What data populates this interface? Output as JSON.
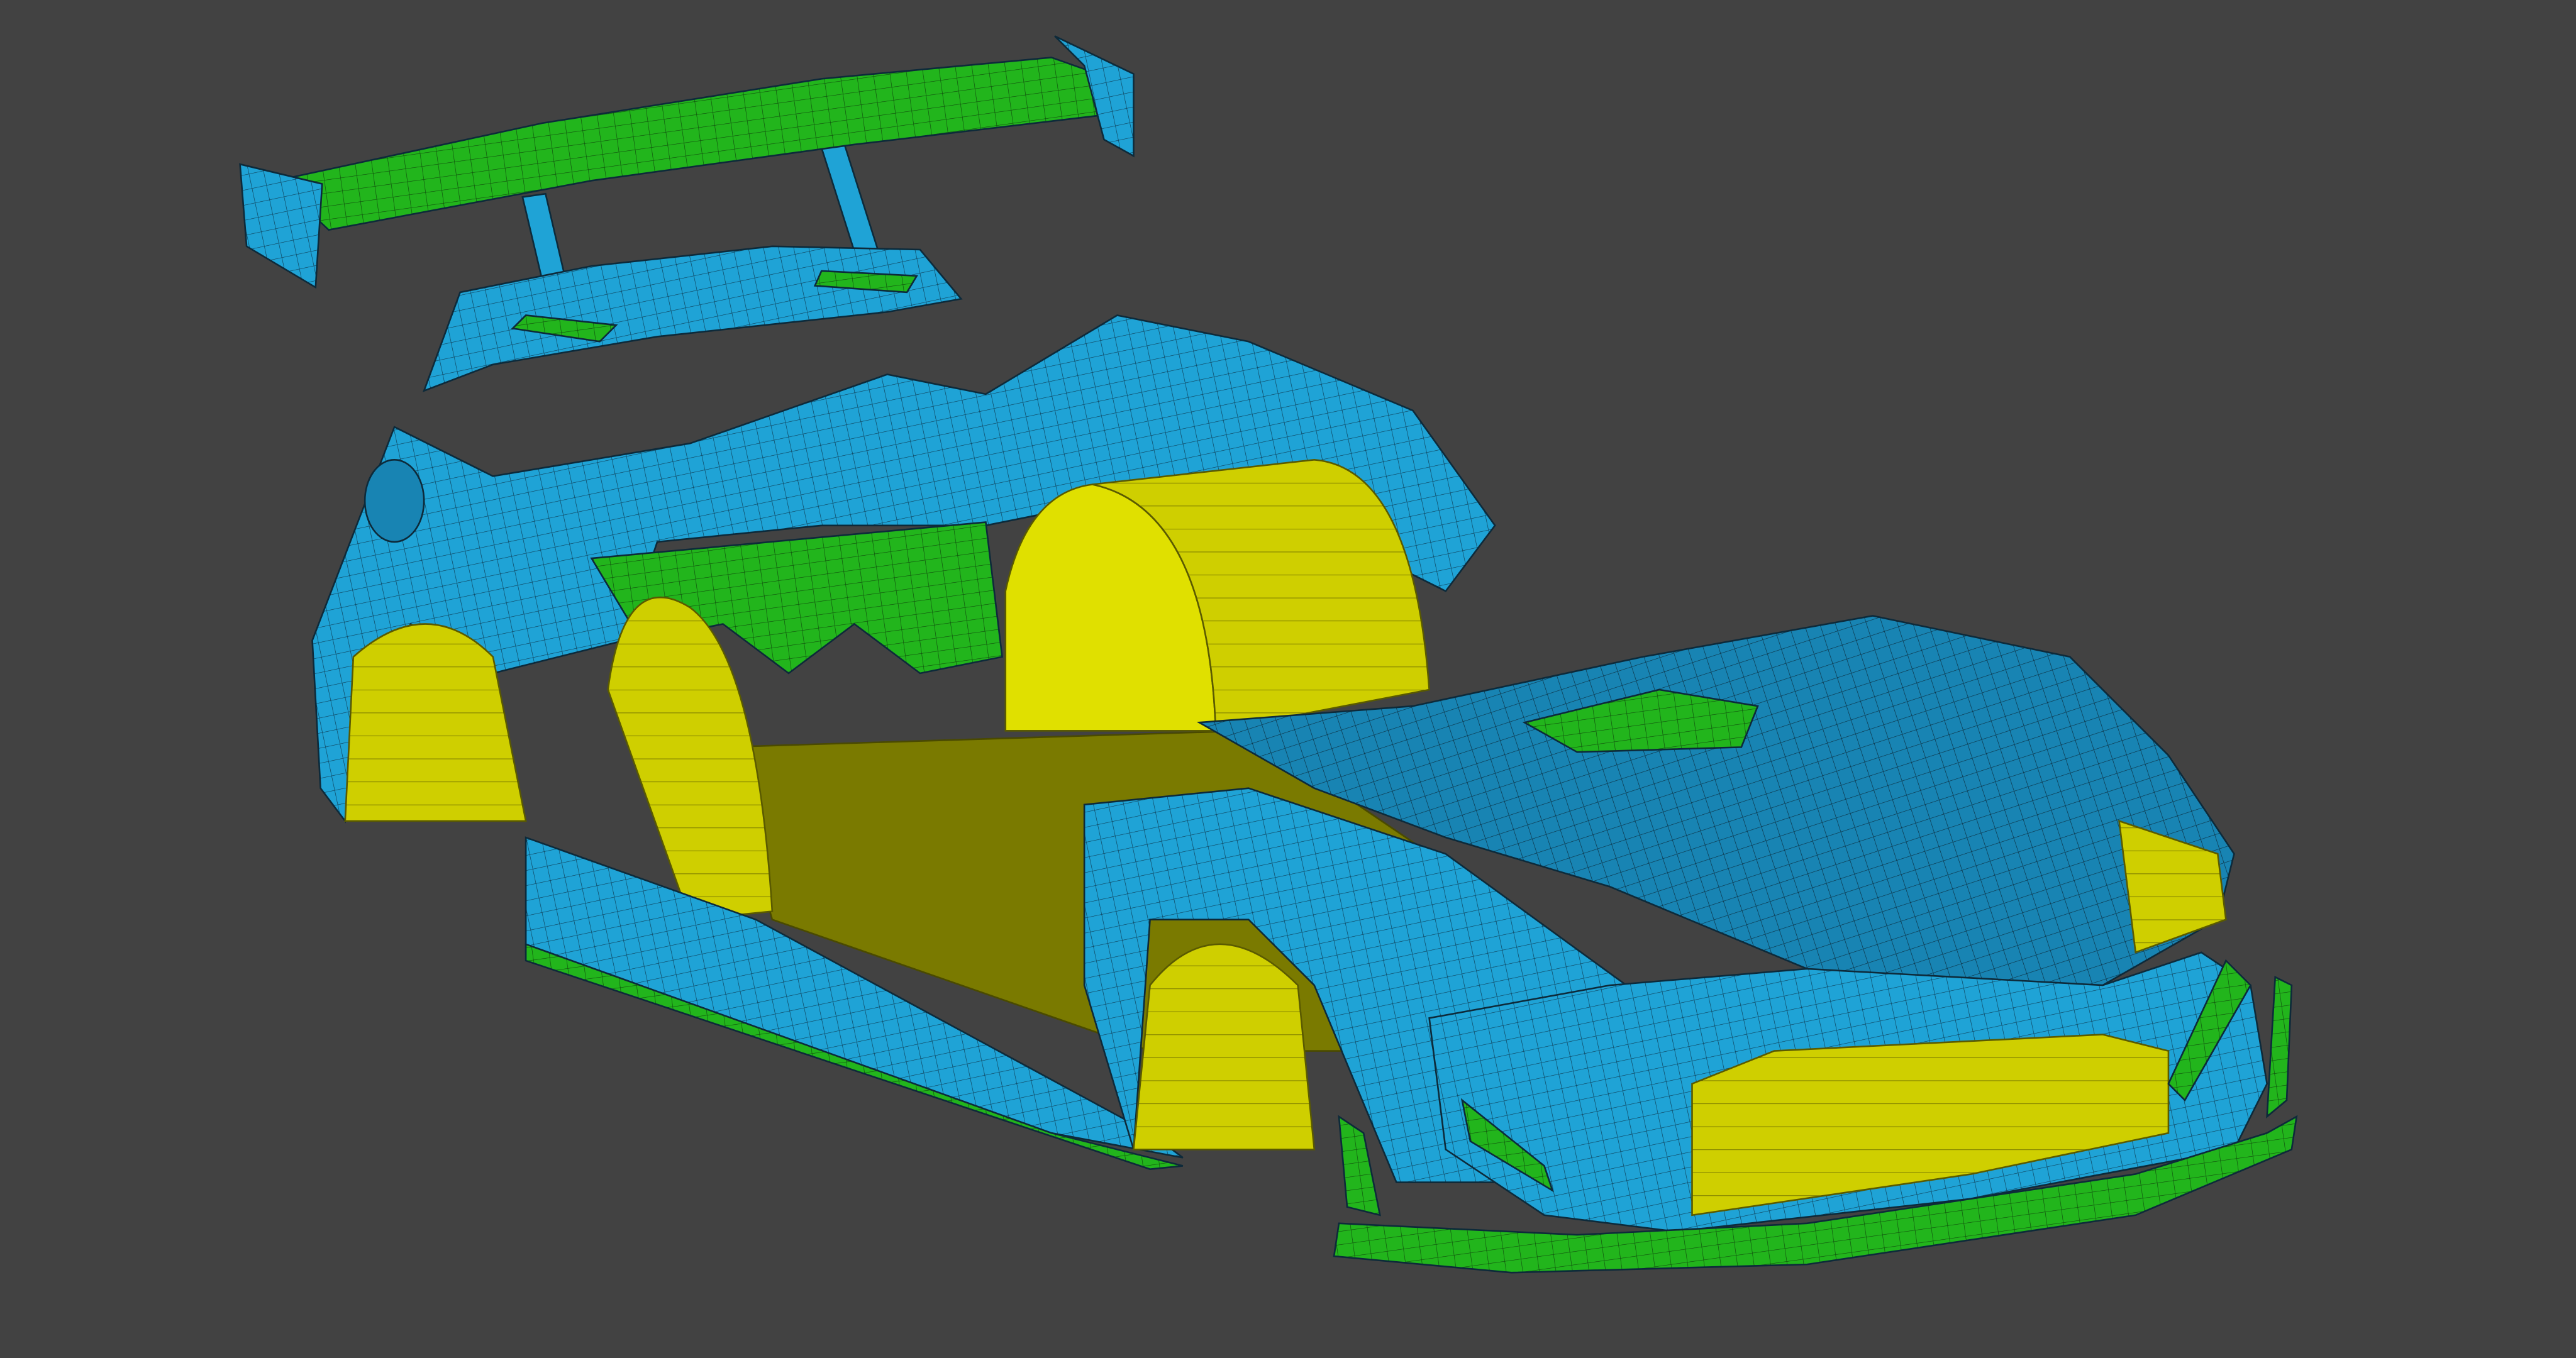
{
  "scene": {
    "colors": {
      "background": "#424242",
      "body_panels": "#1fa3d6",
      "body_panels_dark": "#15779f",
      "aero_parts": "#22b51c",
      "wheel_housings": "#d6d600",
      "floor": "#7a7a00",
      "mesh_lines": "#0d2a3a"
    }
  }
}
